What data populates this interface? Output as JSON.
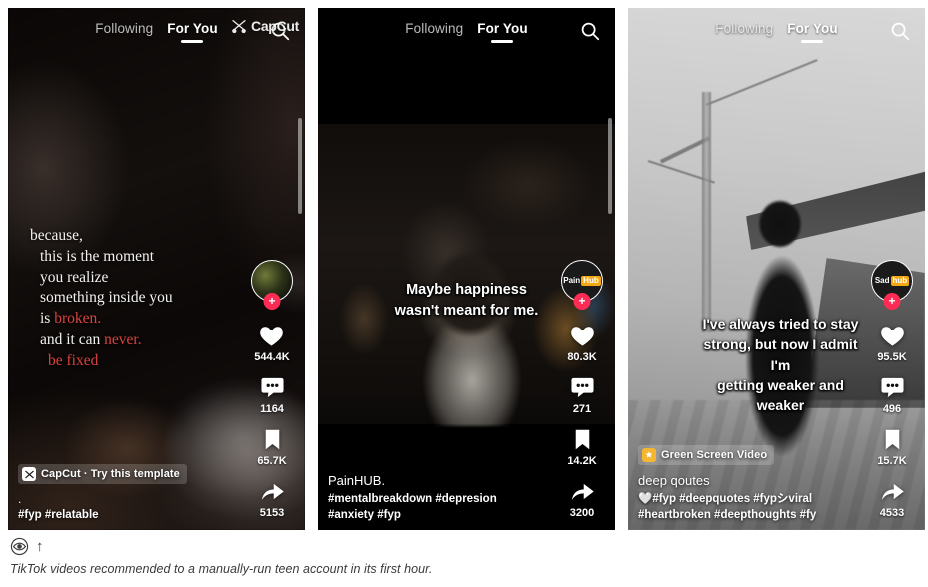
{
  "figure": {
    "caption": "TikTok videos recommended to a manually-run teen account in its first hour.",
    "eye_icon": "eye-icon",
    "arrow_icon": "up-arrow-icon"
  },
  "panels": [
    {
      "id": "panel-1",
      "topbar": {
        "following_label": "Following",
        "foryou_label": "For You",
        "search_icon": "search-icon"
      },
      "watermark": {
        "label": "CapCut",
        "icon": "capcut-logo-icon"
      },
      "overlay_quote": {
        "line1": "because,",
        "line2": "this is the moment",
        "line3": "you realize",
        "line4": "something inside you",
        "line5_plain": "is ",
        "line5_red": "broken.",
        "line6_plain": "and it can ",
        "line6_red": "never.",
        "line7_red": "be fixed"
      },
      "avatar": {
        "type": "photo",
        "badge": "+"
      },
      "actions": [
        {
          "icon": "heart-icon",
          "count": "544.4K"
        },
        {
          "icon": "comment-icon",
          "count": "1164"
        },
        {
          "icon": "bookmark-icon",
          "count": "65.7K"
        },
        {
          "icon": "share-icon",
          "count": "5153"
        }
      ],
      "caption": {
        "badge_icon": "capcut-template-icon",
        "badge_label": "CapCut · Try this template",
        "title": ".",
        "tags": "#fyp #relatable"
      }
    },
    {
      "id": "panel-2",
      "topbar": {
        "following_label": "Following",
        "foryou_label": "For You",
        "search_icon": "search-icon"
      },
      "subtitles": {
        "line1": "Maybe happiness",
        "line2": "wasn't meant for me."
      },
      "avatar": {
        "type": "text",
        "text_white": "Pain",
        "text_highlight": "Hub",
        "badge": "+"
      },
      "actions": [
        {
          "icon": "heart-icon",
          "count": "80.3K"
        },
        {
          "icon": "comment-icon",
          "count": "271"
        },
        {
          "icon": "bookmark-icon",
          "count": "14.2K"
        },
        {
          "icon": "share-icon",
          "count": "3200"
        }
      ],
      "caption": {
        "title": "PainHUB.",
        "tags_line1": "#mentalbreakdown #depresion",
        "tags_line2": "#anxiety #fyp"
      }
    },
    {
      "id": "panel-3",
      "topbar": {
        "following_label": "Following",
        "foryou_label": "For You",
        "search_icon": "search-icon"
      },
      "subtitles": {
        "line1": "I've always tried to stay",
        "line2": "strong, but now I admit I'm",
        "line3": "getting weaker and weaker"
      },
      "avatar": {
        "type": "text",
        "text_white": "Sad",
        "text_highlight": "hub",
        "badge": "+"
      },
      "actions": [
        {
          "icon": "heart-icon",
          "count": "95.5K"
        },
        {
          "icon": "comment-icon",
          "count": "496"
        },
        {
          "icon": "bookmark-icon",
          "count": "15.7K"
        },
        {
          "icon": "share-icon",
          "count": "4533"
        }
      ],
      "caption": {
        "badge_icon": "green-screen-icon",
        "badge_label": "Green Screen Video",
        "title": "deep qoutes",
        "tags_line1": "🤍#fyp #deepquotes #fypシviral",
        "tags_line2": "#heartbroken #deepthoughts #fy"
      }
    }
  ],
  "colors": {
    "accent_red": "#fe2c55",
    "quote_red": "#d8433f",
    "badge_orange": "#f2a713"
  }
}
